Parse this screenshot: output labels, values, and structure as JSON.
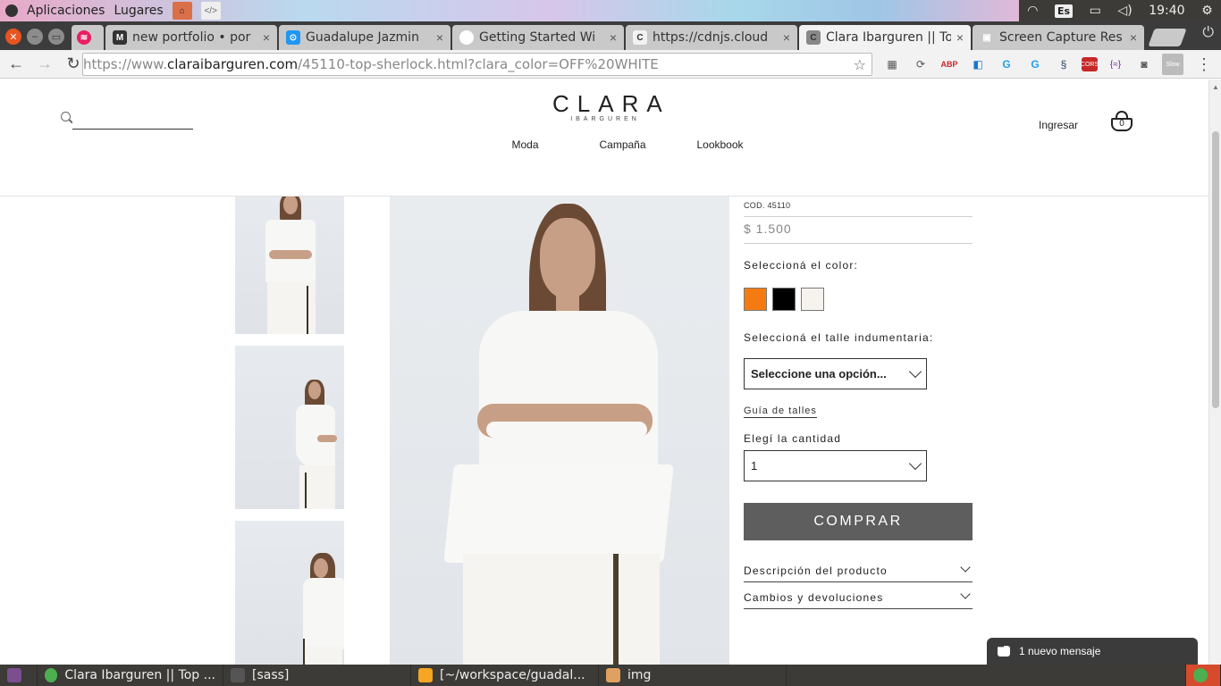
{
  "os": {
    "menus": [
      "Aplicaciones",
      "Lugares"
    ],
    "lang": "Es",
    "clock": "19:40"
  },
  "tabs": [
    {
      "title": "new portfolio • por",
      "fav_color": "#e91e63",
      "fav_text": "M"
    },
    {
      "title": "Guadalupe Jazmin",
      "fav_color": "#333333",
      "fav_text": "⊙"
    },
    {
      "title": "Getting Started Wi",
      "fav_color": "#2196f3",
      "fav_text": "S"
    },
    {
      "title": "https://cdnjs.cloud",
      "fav_color": "#ffffff",
      "fav_text": "C"
    },
    {
      "title": "Clara Ibarguren || To",
      "fav_color": "#f2f2f2",
      "fav_text": "C"
    },
    {
      "title": "Screen Capture Res",
      "fav_color": "#888888",
      "fav_text": "▣"
    }
  ],
  "omnibox": {
    "scheme": "https://www.",
    "host": "claraibarguren.com",
    "path": "/45110-top-sherlock.html?clara_color=OFF%20WHITE"
  },
  "site": {
    "logo_main": "CLARA",
    "logo_sub": "IBARGUREN",
    "nav": [
      "Moda",
      "Campaña",
      "Lookbook"
    ],
    "login": "Ingresar",
    "cart_count": "0",
    "search_placeholder": ""
  },
  "product": {
    "code": "COD. 45110",
    "price": "$ 1.500",
    "color_label": "Seleccioná el color:",
    "colors": [
      {
        "name": "orange",
        "hex": "#f47b12"
      },
      {
        "name": "black",
        "hex": "#000000"
      },
      {
        "name": "off-white",
        "hex": "#f6f3ef"
      }
    ],
    "size_label": "Seleccioná el talle indumentaria:",
    "size_value": "Seleccione una opción...",
    "size_guide": "Guía de talles",
    "qty_label": "Elegí la cantidad",
    "qty_value": "1",
    "buy": "COMPRAR",
    "accordion": [
      "Descripción del producto",
      "Cambios y devoluciones"
    ]
  },
  "chat": {
    "text": "1 nuevo mensaje"
  },
  "taskbar": [
    {
      "label": "Clara Ibarguren || Top ...",
      "icon_color": "#4caf50"
    },
    {
      "label": "[sass]",
      "icon_color": "#555555"
    },
    {
      "label": "[~/workspace/guadal...",
      "icon_color": "#f5a623"
    },
    {
      "label": "img",
      "icon_color": "#e0a060"
    }
  ]
}
